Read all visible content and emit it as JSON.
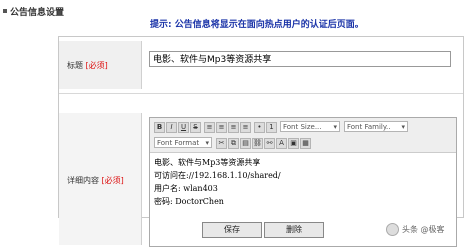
{
  "title": "公告信息设置",
  "hint": "提示: 公告信息将显示在面向热点用户的认证后页面。",
  "form": {
    "title_label": "标题",
    "title_required": "[必须]",
    "title_value": "电影、软件与Mp3等资源共享",
    "detail_label": "详细内容",
    "detail_required": "[必须]"
  },
  "editor": {
    "font_size": "Font Size...",
    "font_family": "Font Family..",
    "font_format": "Font Format",
    "lines": [
      "电影、软件与Mp3等资源共享",
      "可访问在://192.168.1.10/shared/",
      "用户名: wlan403",
      "密码: DoctorChen"
    ]
  },
  "buttons": {
    "save": "保存",
    "delete": "删除"
  },
  "watermark": "头条 @极客"
}
